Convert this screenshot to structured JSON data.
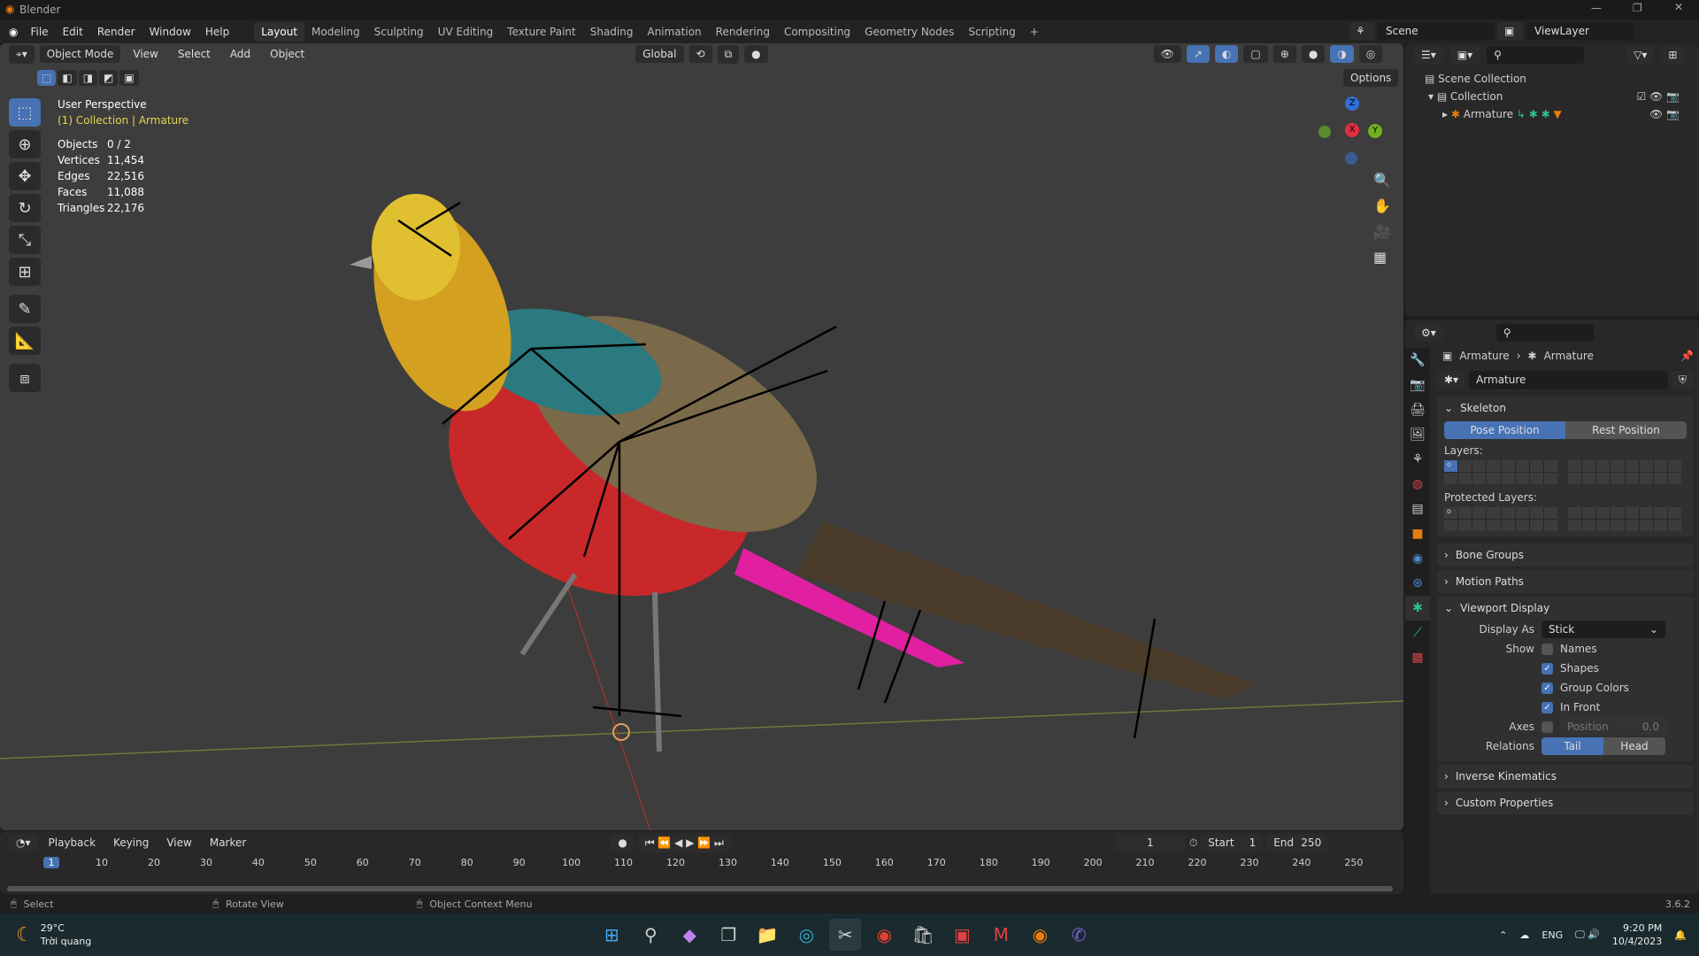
{
  "window": {
    "title": "Blender"
  },
  "menu": [
    "File",
    "Edit",
    "Render",
    "Window",
    "Help"
  ],
  "workspaces": [
    "Layout",
    "Modeling",
    "Sculpting",
    "UV Editing",
    "Texture Paint",
    "Shading",
    "Animation",
    "Rendering",
    "Compositing",
    "Geometry Nodes",
    "Scripting"
  ],
  "scene": {
    "name": "Scene",
    "view_layer": "ViewLayer"
  },
  "viewport": {
    "mode": "Object Mode",
    "menus": [
      "View",
      "Select",
      "Add",
      "Object"
    ],
    "orientation": "Global",
    "options": "Options",
    "view_name": "User Perspective",
    "context": "(1) Collection | Armature",
    "stats": [
      {
        "label": "Objects",
        "value": "0 / 2"
      },
      {
        "label": "Vertices",
        "value": "11,454"
      },
      {
        "label": "Edges",
        "value": "22,516"
      },
      {
        "label": "Faces",
        "value": "11,088"
      },
      {
        "label": "Triangles",
        "value": "22,176"
      }
    ],
    "gizmo": {
      "z": "Z",
      "x": "X",
      "y": "Y"
    }
  },
  "outliner": {
    "items": [
      {
        "label": "Scene Collection"
      },
      {
        "label": "Collection"
      },
      {
        "label": "Armature"
      }
    ]
  },
  "properties": {
    "breadcrumb": [
      "Armature",
      "Armature"
    ],
    "data_name": "Armature",
    "skeleton": {
      "title": "Skeleton",
      "pose": "Pose Position",
      "rest": "Rest Position",
      "layers": "Layers:",
      "protected": "Protected Layers:"
    },
    "collapsed": [
      "Bone Groups",
      "Motion Paths"
    ],
    "viewport_display": {
      "title": "Viewport Display",
      "display_as_label": "Display As",
      "display_as": "Stick",
      "show_label": "Show",
      "checks": [
        {
          "label": "Names",
          "on": false
        },
        {
          "label": "Shapes",
          "on": true
        },
        {
          "label": "Group Colors",
          "on": true
        },
        {
          "label": "In Front",
          "on": true
        }
      ],
      "axes_label": "Axes",
      "axes_pos": "Position",
      "axes_val": "0.0",
      "relations_label": "Relations",
      "tail": "Tail",
      "head": "Head"
    },
    "collapsed2": [
      "Inverse Kinematics",
      "Custom Properties"
    ]
  },
  "timeline": {
    "menus": [
      "Playback",
      "Keying",
      "View",
      "Marker"
    ],
    "current": "1",
    "start_label": "Start",
    "start": "1",
    "end_label": "End",
    "end": "250",
    "ticks": [
      1,
      10,
      20,
      30,
      40,
      50,
      60,
      70,
      80,
      90,
      100,
      110,
      120,
      130,
      140,
      150,
      160,
      170,
      180,
      190,
      200,
      210,
      220,
      230,
      240,
      250
    ]
  },
  "status": {
    "select": "Select",
    "rotate": "Rotate View",
    "context": "Object Context Menu",
    "version": "3.6.2"
  },
  "taskbar": {
    "temp": "29°C",
    "weather": "Trời quang",
    "lang": "ENG",
    "time": "9:20 PM",
    "date": "10/4/2023"
  },
  "colors": {
    "accent": "#4772b3",
    "viewport": "#3d3d3d",
    "context": "#e8d64a"
  }
}
